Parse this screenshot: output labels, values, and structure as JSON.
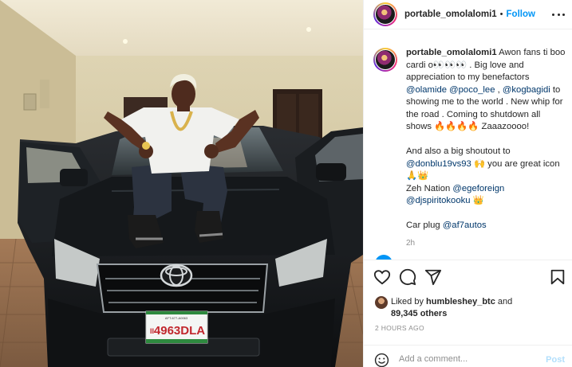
{
  "post": {
    "username": "portable_omolalomi1",
    "dot": "•",
    "follow_label": "Follow",
    "more_icon": "more-horizontal-icon",
    "plate": {
      "top_text": "AFT-677-A0063",
      "number": "4963DLA",
      "side": "II"
    },
    "caption": {
      "username": "portable_omolalomi1",
      "line1": " Awon fans ti boo cardi o👀👀👀 . Big love and appreciation to my benefactors ",
      "mention1": "@olamide",
      "sep1": " ",
      "mention2": "@poco_lee",
      "sep2": " , ",
      "mention3": "@kogbagidi",
      "line2": " to showing me to the world . New whip for the road . Coming to shutdown all shows 🔥🔥🔥🔥 Zaaazoooo!",
      "para2_text": "And also a big shoutout to ",
      "mention4": "@donblu19vs93",
      "para2_rest": " 🙌 you are great icon 🙏👑",
      "para3_text": "Zeh Nation ",
      "mention5": "@egeforeign",
      "mention6": "@djspiritokooku",
      "para3_rest": " 👑",
      "para4_text": "Car plug ",
      "mention7": "@af7autos",
      "time": "2h"
    },
    "likes": {
      "prefix": "Liked by ",
      "user": "humbleshey_btc",
      "middle": " and",
      "count": "89,345 others"
    },
    "posted": "2 HOURS AGO",
    "comment": {
      "placeholder": "Add a comment...",
      "post_label": "Post"
    },
    "icons": {
      "like": "heart-icon",
      "comment": "comment-icon",
      "share": "paper-plane-icon",
      "save": "bookmark-icon",
      "emoji": "smiley-icon"
    },
    "colors": {
      "link": "#0095f6",
      "mention": "#00376b",
      "muted": "#8e8e8e",
      "post_disabled": "#b2dffc"
    }
  }
}
